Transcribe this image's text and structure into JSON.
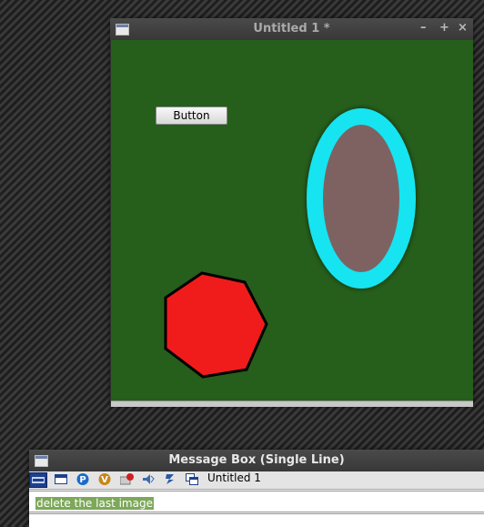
{
  "canvas_window": {
    "title": "Untitled 1 *",
    "controls": {
      "minimize": "–",
      "maximize": "+",
      "close": "×"
    },
    "canvas": {
      "background": "#265e1b",
      "button_label": "Button",
      "shapes": {
        "ellipse": {
          "fill": "#7e6262",
          "stroke": "#17e4f0"
        },
        "heptagon": {
          "fill": "#f01c1c",
          "stroke": "#000000"
        }
      }
    }
  },
  "message_window": {
    "title": "Message Box (Single Line)",
    "toolbar": {
      "icons": [
        "text-box-icon",
        "window-icon",
        "p-icon",
        "v-icon",
        "mail-icon",
        "speaker-icon",
        "sound-icon",
        "windows-icon"
      ],
      "document_label": "Untitled 1"
    },
    "input_text": "delete the last image"
  }
}
